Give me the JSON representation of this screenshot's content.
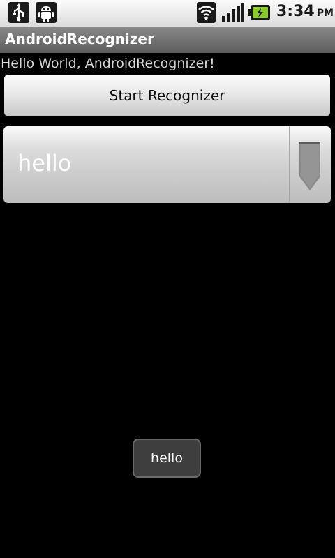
{
  "status_bar": {
    "time": "3:34",
    "ampm": "PM",
    "icons": [
      "usb-icon",
      "debug-android-icon",
      "wifi-icon",
      "signal-icon",
      "battery-charging-icon"
    ]
  },
  "title_bar": {
    "title": "AndroidRecognizer"
  },
  "main": {
    "greeting": "Hello World, AndroidRecognizer!",
    "start_button_label": "Start Recognizer",
    "spinner_selected": "hello"
  },
  "toast": {
    "message": "hello"
  }
}
